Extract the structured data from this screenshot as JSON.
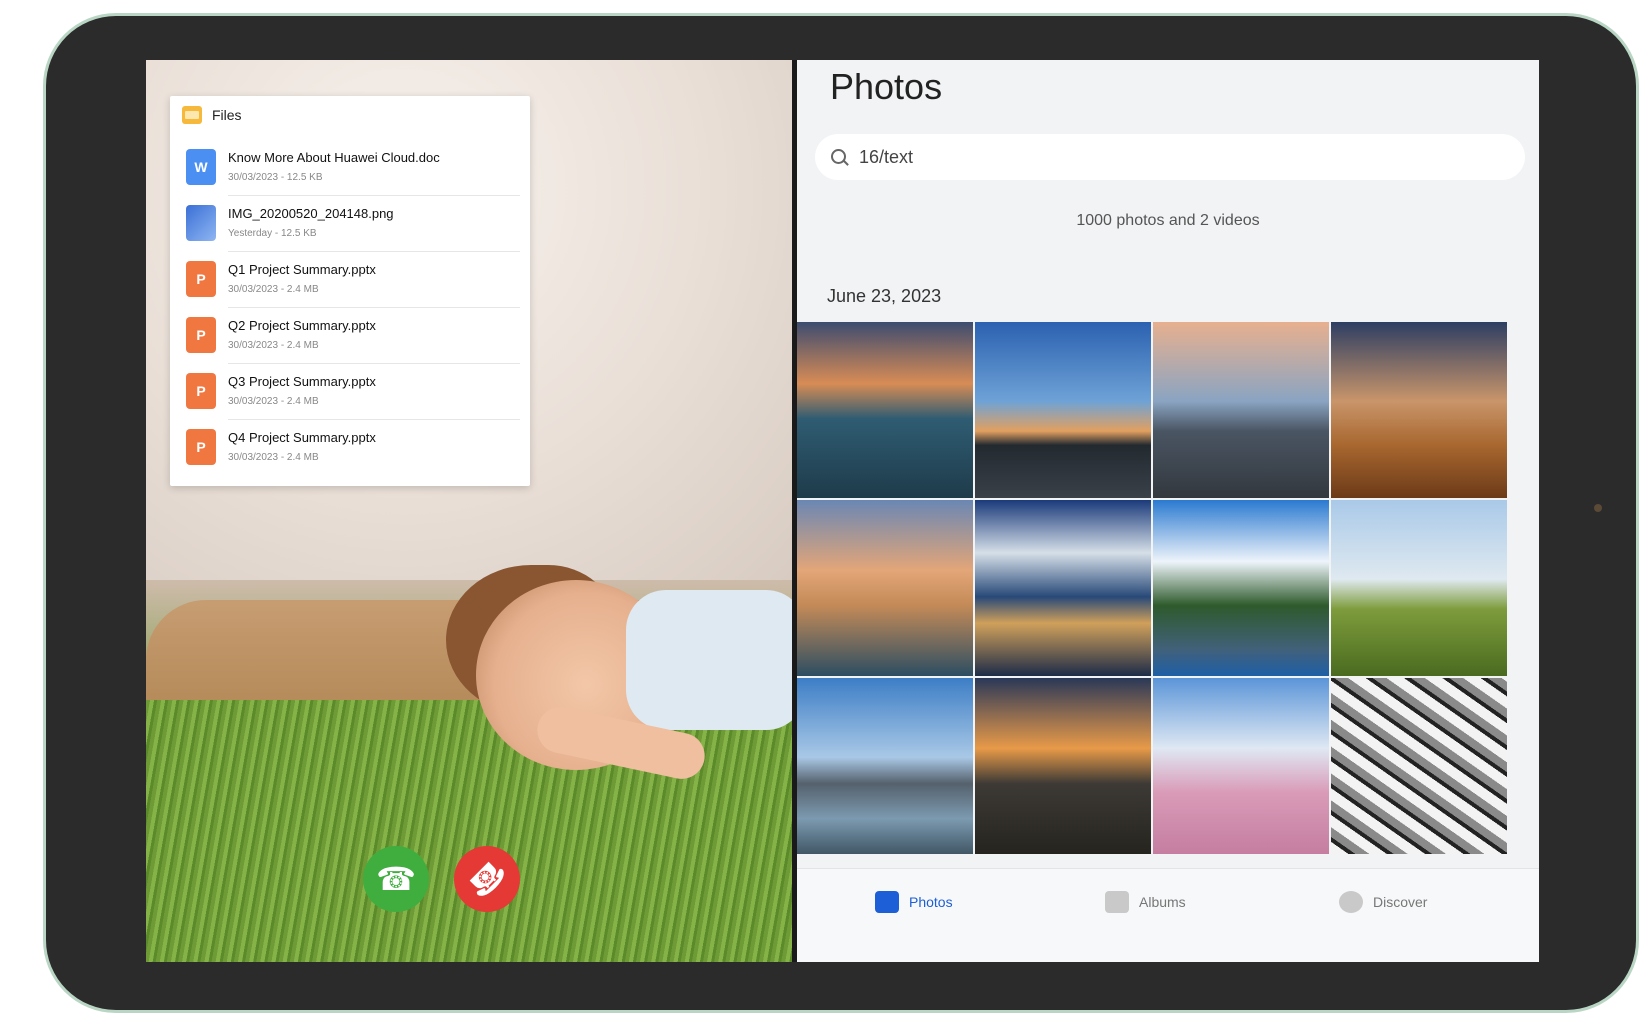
{
  "files_panel": {
    "title": "Files",
    "items": [
      {
        "name": "Know More About Huawei Cloud.doc",
        "meta": "30/03/2023  - 12.5 KB",
        "icon": "word-doc-icon",
        "glyph": "W"
      },
      {
        "name": "IMG_20200520_204148.png",
        "meta": "Yesterday - 12.5 KB",
        "icon": "image-file-icon",
        "glyph": ""
      },
      {
        "name": "Q1 Project Summary.pptx",
        "meta": "30/03/2023 - 2.4 MB",
        "icon": "ppt-file-icon",
        "glyph": "P"
      },
      {
        "name": "Q2 Project Summary.pptx",
        "meta": "30/03/2023 - 2.4 MB",
        "icon": "ppt-file-icon",
        "glyph": "P"
      },
      {
        "name": "Q3 Project Summary.pptx",
        "meta": "30/03/2023 - 2.4 MB",
        "icon": "ppt-file-icon",
        "glyph": "P"
      },
      {
        "name": "Q4 Project Summary.pptx",
        "meta": "30/03/2023 - 2.4 MB",
        "icon": "ppt-file-icon",
        "glyph": "P"
      }
    ]
  },
  "call": {
    "accept_icon": "phone-accept-icon",
    "decline_icon": "phone-decline-icon",
    "accept_color": "#3fae3f",
    "decline_color": "#e53935"
  },
  "photos": {
    "title": "Photos",
    "search_value": "16/text",
    "count_text": "1000 photos and 2 videos",
    "date_heading": "June 23, 2023",
    "tabs": [
      {
        "label": "Photos",
        "icon": "photos-icon",
        "active": true
      },
      {
        "label": "Albums",
        "icon": "albums-icon",
        "active": false
      },
      {
        "label": "Discover",
        "icon": "discover-icon",
        "active": false
      }
    ],
    "accent_color": "#1d5fd6"
  }
}
